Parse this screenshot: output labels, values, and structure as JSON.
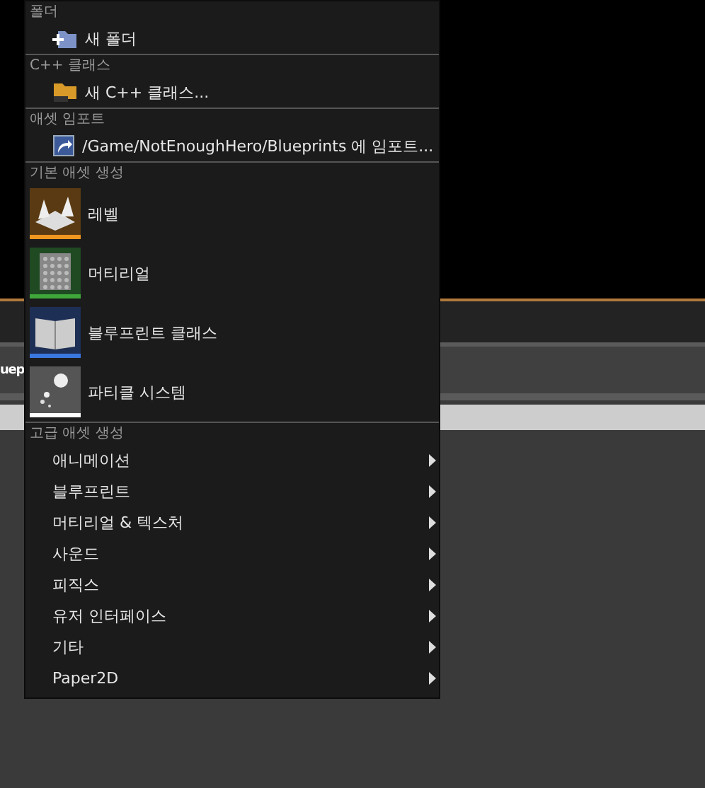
{
  "backdrop": {
    "tab_label": "uep"
  },
  "menu": {
    "sections": [
      {
        "header": "폴더",
        "items": [
          {
            "kind": "small",
            "label": "새 폴더"
          }
        ]
      },
      {
        "header": "C++ 클래스",
        "items": [
          {
            "kind": "small",
            "label": "새 C++ 클래스..."
          }
        ]
      },
      {
        "header": "애셋 임포트",
        "items": [
          {
            "kind": "small",
            "label": "/Game/NotEnoughHero/Blueprints 에 임포트..."
          }
        ]
      },
      {
        "header": "기본 애셋 생성",
        "items": [
          {
            "kind": "large",
            "label": "레벨",
            "color": "#f0961e"
          },
          {
            "kind": "large",
            "label": "머티리얼",
            "color": "#3fa83a"
          },
          {
            "kind": "large",
            "label": "블루프린트 클래스",
            "color": "#3a78e0"
          },
          {
            "kind": "large",
            "label": "파티클 시스템",
            "color": "#ffffff"
          }
        ]
      },
      {
        "header": "고급 애셋 생성",
        "items": [
          {
            "kind": "submenu",
            "label": "애니메이션"
          },
          {
            "kind": "submenu",
            "label": "블루프린트"
          },
          {
            "kind": "submenu",
            "label": "머티리얼 & 텍스처"
          },
          {
            "kind": "submenu",
            "label": "사운드"
          },
          {
            "kind": "submenu",
            "label": "피직스"
          },
          {
            "kind": "submenu",
            "label": "유저 인터페이스"
          },
          {
            "kind": "submenu",
            "label": "기타"
          },
          {
            "kind": "submenu",
            "label": "Paper2D"
          }
        ]
      }
    ]
  }
}
